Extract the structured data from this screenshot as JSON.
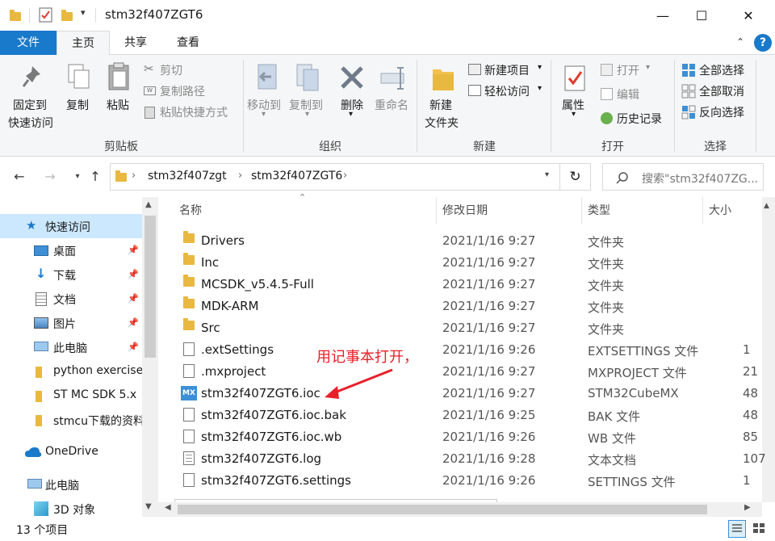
{
  "title": "stm32f407ZGT6",
  "window_controls": {
    "minimize": "—",
    "maximize": "☐",
    "close": "✕"
  },
  "tabs": [
    {
      "label": "文件"
    },
    {
      "label": "主页"
    },
    {
      "label": "共享"
    },
    {
      "label": "查看"
    }
  ],
  "ribbon": {
    "clipboard": {
      "pin": "固定到\n快速访问",
      "pin_line1": "固定到",
      "pin_line2": "快速访问",
      "copy": "复制",
      "paste": "粘贴",
      "cut": "剪切",
      "copy_path": "复制路径",
      "paste_shortcut": "粘贴快捷方式",
      "label": "剪贴板"
    },
    "organize": {
      "move_to": "移动到",
      "copy_to": "复制到",
      "delete": "删除",
      "rename": "重命名",
      "label": "组织"
    },
    "new": {
      "new_folder_line1": "新建",
      "new_folder_line2": "文件夹",
      "new_item": "新建项目",
      "easy_access": "轻松访问",
      "label": "新建"
    },
    "open": {
      "properties": "属性",
      "open": "打开",
      "edit": "编辑",
      "history": "历史记录",
      "label": "打开"
    },
    "select": {
      "select_all": "全部选择",
      "select_none": "全部取消",
      "invert": "反向选择",
      "label": "选择"
    }
  },
  "address": {
    "crumbs": [
      "stm32f407zgt",
      "stm32f407ZGT6"
    ],
    "search_placeholder": "搜索\"stm32f407ZG..."
  },
  "nav": {
    "items": [
      {
        "label": "快速访问",
        "icon": "star-icon"
      },
      {
        "label": "桌面",
        "icon": "desktop-icon"
      },
      {
        "label": "下载",
        "icon": "download-icon"
      },
      {
        "label": "文档",
        "icon": "document-icon"
      },
      {
        "label": "图片",
        "icon": "pictures-icon"
      },
      {
        "label": "此电脑",
        "icon": "computer-icon"
      },
      {
        "label": "python exercise",
        "icon": "folder-icon"
      },
      {
        "label": "ST MC SDK 5.x",
        "icon": "folder-icon"
      },
      {
        "label": "stmcu下载的资料",
        "icon": "folder-icon"
      },
      {
        "label": "OneDrive",
        "icon": "cloud-icon"
      },
      {
        "label": "此电脑",
        "icon": "computer-icon"
      },
      {
        "label": "3D 对象",
        "icon": "cube-icon"
      }
    ]
  },
  "columns": {
    "name": "名称",
    "date": "修改日期",
    "type": "类型",
    "size": "大小"
  },
  "files": [
    {
      "name": "Drivers",
      "date": "2021/1/16 9:27",
      "type": "文件夹",
      "size": "",
      "icon": "folder"
    },
    {
      "name": "Inc",
      "date": "2021/1/16 9:27",
      "type": "文件夹",
      "size": "",
      "icon": "folder"
    },
    {
      "name": "MCSDK_v5.4.5-Full",
      "date": "2021/1/16 9:27",
      "type": "文件夹",
      "size": "",
      "icon": "folder"
    },
    {
      "name": "MDK-ARM",
      "date": "2021/1/16 9:27",
      "type": "文件夹",
      "size": "",
      "icon": "folder"
    },
    {
      "name": "Src",
      "date": "2021/1/16 9:27",
      "type": "文件夹",
      "size": "",
      "icon": "folder"
    },
    {
      "name": ".extSettings",
      "date": "2021/1/16 9:26",
      "type": "EXTSETTINGS 文件",
      "size": "1",
      "icon": "file"
    },
    {
      "name": ".mxproject",
      "date": "2021/1/16 9:27",
      "type": "MXPROJECT 文件",
      "size": "21",
      "icon": "file"
    },
    {
      "name": "stm32f407ZGT6.ioc",
      "date": "2021/1/16 9:27",
      "type": "STM32CubeMX",
      "size": "48",
      "icon": "mx"
    },
    {
      "name": "stm32f407ZGT6.ioc.bak",
      "date": "2021/1/16 9:25",
      "type": "BAK 文件",
      "size": "48",
      "icon": "file"
    },
    {
      "name": "stm32f407ZGT6.ioc.wb",
      "date": "2021/1/16 9:26",
      "type": "WB 文件",
      "size": "85",
      "icon": "file"
    },
    {
      "name": "stm32f407ZGT6.log",
      "date": "2021/1/16 9:28",
      "type": "文本文档",
      "size": "107",
      "icon": "text"
    },
    {
      "name": "stm32f407ZGT6.settings",
      "date": "2021/1/16 9:26",
      "type": "SETTINGS 文件",
      "size": "1",
      "icon": "file"
    }
  ],
  "annotation": {
    "text": "用记事本打开，",
    "color": "#e8202a"
  },
  "status": {
    "count": "13 个项目"
  },
  "colors": {
    "accent": "#1979ca",
    "selection": "#cce8ff",
    "folder": "#e8b840"
  }
}
